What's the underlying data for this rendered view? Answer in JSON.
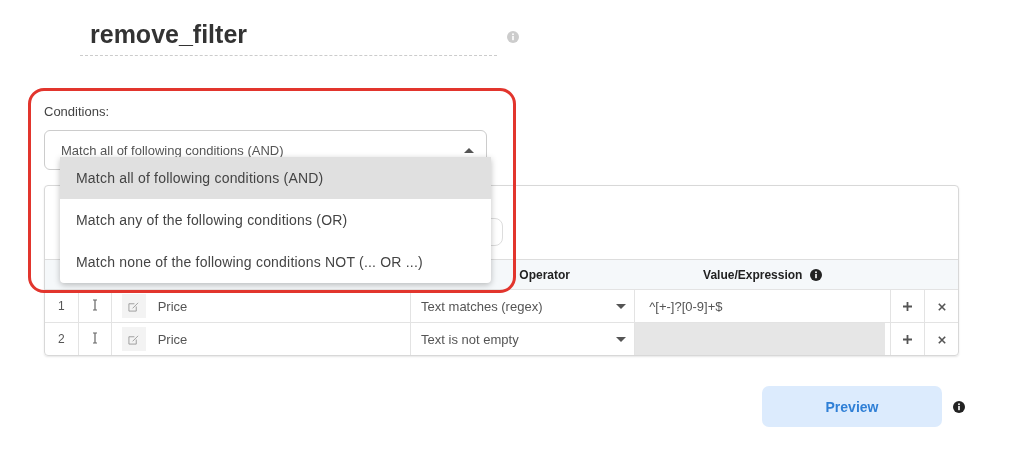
{
  "title": "remove_filter",
  "conditions": {
    "label": "Conditions:",
    "value": "Match all of following conditions (AND)",
    "expanded": true,
    "options": [
      {
        "label": "Match all of following conditions (AND)",
        "selected": true
      },
      {
        "label": "Match any of the following conditions (OR)",
        "selected": false
      },
      {
        "label": "Match none of the following conditions NOT (... OR ...)",
        "selected": false
      }
    ]
  },
  "table": {
    "columns": [
      "Operator",
      "Value/Expression"
    ],
    "rows": [
      {
        "index": "1",
        "field": "Price",
        "operator": "Text matches (regex)",
        "value": "^[+-]?[0-9]+$",
        "value_disabled": false
      },
      {
        "index": "2",
        "field": "Price",
        "operator": "Text is not empty",
        "value": "",
        "value_disabled": true
      }
    ]
  },
  "preview_button": "Preview"
}
